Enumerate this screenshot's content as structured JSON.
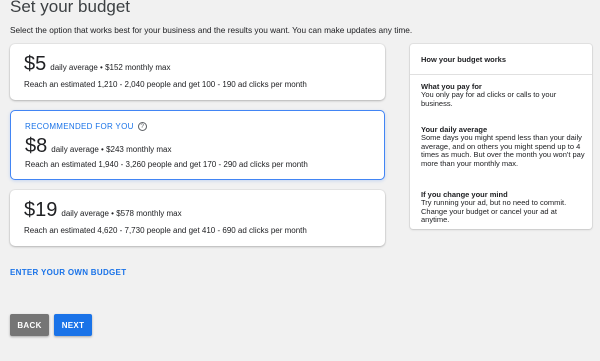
{
  "page": {
    "title": "Set your budget",
    "subtitle": "Select the option that works best for your business and the results you want. You can make updates any time."
  },
  "options": [
    {
      "price": "$5",
      "desc": "daily average • $152 monthly max",
      "reach": "Reach an estimated 1,210 - 2,040 people and get 100 - 190 ad clicks per month"
    },
    {
      "recommended_label": "RECOMMENDED FOR YOU",
      "help_glyph": "?",
      "price": "$8",
      "desc": "daily average • $243 monthly max",
      "reach": "Reach an estimated 1,940 - 3,260 people and get 170 - 290 ad clicks per month"
    },
    {
      "price": "$19",
      "desc": "daily average • $578 monthly max",
      "reach": "Reach an estimated 4,620 - 7,730 people and get 410 - 690 ad clicks per month"
    }
  ],
  "own_budget_link": "ENTER YOUR OWN BUDGET",
  "buttons": {
    "back": "BACK",
    "next": "NEXT"
  },
  "info": {
    "title": "How your budget works",
    "sections": [
      {
        "heading": "What you pay for",
        "text": "You only pay for ad clicks or calls to your business."
      },
      {
        "heading": "Your daily average",
        "text": "Some days you might spend less than your daily average, and on others you might spend up to 4 times as much. But over the month you won't pay more than your monthly max."
      },
      {
        "heading": "If you change your mind",
        "text": "Try running your ad, but no need to commit. Change your budget or cancel your ad at anytime."
      }
    ]
  },
  "colors": {
    "accent": "#1a73e8",
    "selected_border": "#4285f4",
    "back_button": "#757575",
    "background": "#f1f1f1"
  }
}
